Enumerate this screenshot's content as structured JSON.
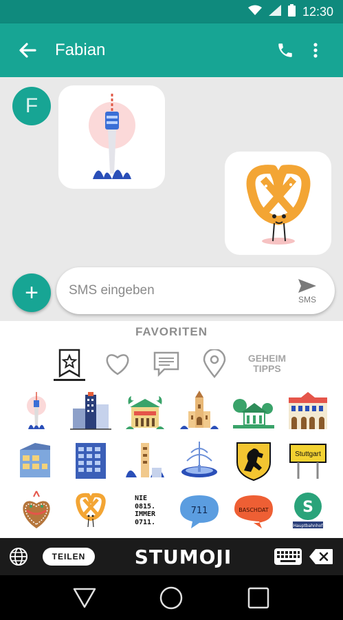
{
  "status_bar": {
    "time": "12:30"
  },
  "header": {
    "title": "Fabian"
  },
  "conversation": {
    "avatar_letter": "F"
  },
  "compose": {
    "placeholder": "SMS eingeben",
    "send_label": "SMS"
  },
  "keyboard": {
    "category_title": "FAVORITEN",
    "categories": [
      "star-flag-icon",
      "heart-icon",
      "chat-bubble-icon",
      "location-pin-icon"
    ],
    "secret_tab": [
      "GEHEIM",
      "TIPPS"
    ],
    "stickers": [
      "tv-tower-sticker",
      "office-tower-sticker",
      "palace-sticker",
      "church-sticker",
      "pavilion-sticker",
      "stock-exchange-sticker",
      "glass-building-sticker",
      "blue-building-sticker",
      "tower-buildings-sticker",
      "fountain-sticker",
      "stuttgart-horse-crest-sticker",
      "stuttgart-sign-sticker",
      "gingerbread-heart-sticker",
      "pretzel-sticker",
      "text-nie-0815-sticker",
      "bubble-711-sticker",
      "bubble-baschdat-sticker",
      "s-bahn-sign-sticker"
    ],
    "text_sticker_lines": [
      "NIE",
      "0815.",
      "IMMER",
      "0711."
    ],
    "bubble_711": "711",
    "bubble_baschdat": "BASCHDAT",
    "sign_stuttgart": "Stuttgart",
    "s_bahn_letter": "S",
    "s_bahn_sub": "Hauptbahnhof"
  },
  "bottom_bar": {
    "share_label": "TEILEN",
    "brand": "STUMOJI"
  },
  "colors": {
    "primary": "#17a594",
    "primary_dark": "#0f8a7d",
    "bar": "#1b1b1b"
  }
}
